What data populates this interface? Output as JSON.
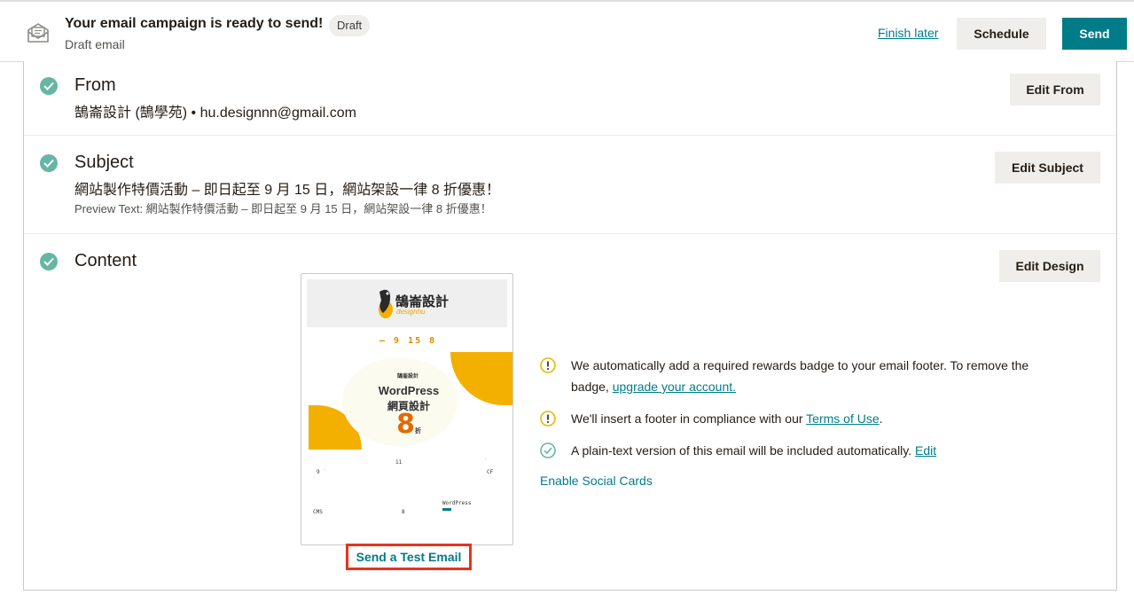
{
  "header": {
    "title": "Your email campaign is ready to send!",
    "badge": "Draft",
    "subtitle": "Draft email",
    "finish_later": "Finish later",
    "schedule": "Schedule",
    "send": "Send"
  },
  "from": {
    "title": "From",
    "value": "鵠崙設計 (鵠學苑) • hu.designnn@gmail.com",
    "edit": "Edit From"
  },
  "subject": {
    "title": "Subject",
    "value": "網站製作特價活動 – 即日起至 9 月 15 日，網站架設一律 8 折優惠！",
    "preview": "Preview Text: 網站製作特價活動 – 即日起至 9 月 15 日，網站架設一律 8 折優惠！",
    "edit": "Edit Subject"
  },
  "content": {
    "title": "Content",
    "edit": "Edit Design",
    "send_test": "Send a Test Email",
    "preview": {
      "brand": "鵠崙設計",
      "brand_sub": "designhu",
      "date_line": "– 9 15   8",
      "banner_brand": "鵠崙設計",
      "banner_line1": "WordPress",
      "banner_line2": "網頁設計",
      "banner_number": "8",
      "banner_number_suffix": "折",
      "tiny_1": "11",
      "tiny_2": "9 ˙",
      "tiny_3": "˙",
      "tiny_4": "CF",
      "tiny_5": "WordPress",
      "tiny_6": "CMS",
      "tiny_7": "8"
    },
    "notices": [
      {
        "icon": "warning-icon",
        "text": "We automatically add a required rewards badge to your email footer. To remove the badge, ",
        "link": "upgrade your account.",
        "after": ""
      },
      {
        "icon": "warning-icon",
        "text": "We'll insert a footer in compliance with our ",
        "link": "Terms of Use",
        "after": "."
      },
      {
        "icon": "check-circle-icon",
        "text": "A plain-text version of this email will be included automatically. ",
        "link": "Edit",
        "after": ""
      }
    ],
    "social_cards": "Enable Social Cards"
  },
  "colors": {
    "accent": "#007c89",
    "check": "#66b6a5",
    "warning": "#e8b800",
    "highlight_border": "#e8321c"
  }
}
